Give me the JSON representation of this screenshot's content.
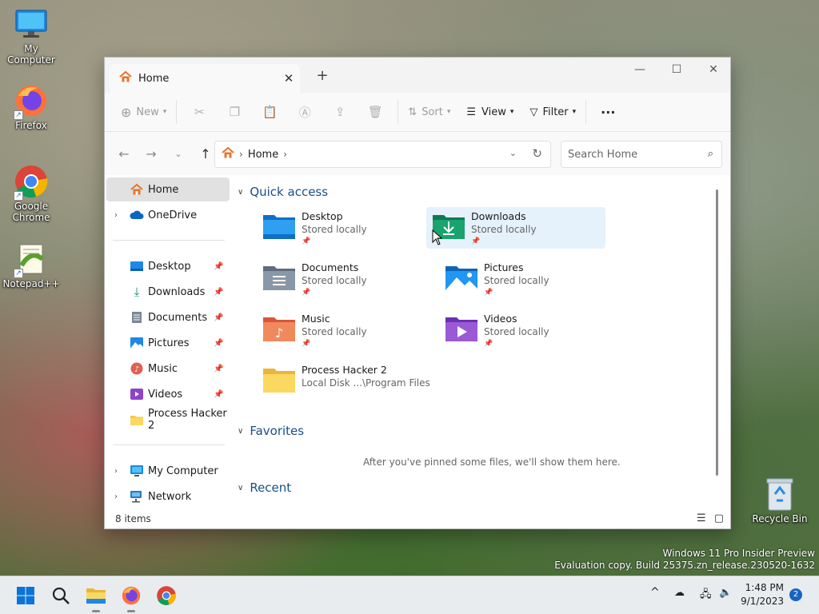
{
  "desktop": {
    "icons": [
      {
        "label": "My Computer"
      },
      {
        "label": "Firefox"
      },
      {
        "label": "Google Chrome"
      },
      {
        "label": "Notepad++"
      },
      {
        "label": "Recycle Bin"
      }
    ],
    "watermark": [
      "Windows 11 Pro Insider Preview",
      "Evaluation copy. Build 25375.zn_release.230520-1632"
    ]
  },
  "explorer": {
    "tab_title": "Home",
    "new_tab_symbol": "+",
    "toolbar": {
      "new": "New",
      "sort": "Sort",
      "view": "View",
      "filter": "Filter",
      "more": "···"
    },
    "address": {
      "crumb": "Home"
    },
    "search": {
      "placeholder": "Search Home"
    },
    "sidebar": {
      "home": "Home",
      "onedrive": "OneDrive",
      "pinned": [
        {
          "label": "Desktop"
        },
        {
          "label": "Downloads"
        },
        {
          "label": "Documents"
        },
        {
          "label": "Pictures"
        },
        {
          "label": "Music"
        },
        {
          "label": "Videos"
        },
        {
          "label": "Process Hacker 2"
        }
      ],
      "my_computer": "My Computer",
      "network": "Network"
    },
    "sections": {
      "quick_access": "Quick access",
      "favorites": "Favorites",
      "recent": "Recent",
      "favorites_empty": "After you've pinned some files, we'll show them here."
    },
    "quick_access": [
      {
        "name": "Desktop",
        "sub": "Stored locally"
      },
      {
        "name": "Downloads",
        "sub": "Stored locally"
      },
      {
        "name": "Documents",
        "sub": "Stored locally"
      },
      {
        "name": "Pictures",
        "sub": "Stored locally"
      },
      {
        "name": "Music",
        "sub": "Stored locally"
      },
      {
        "name": "Videos",
        "sub": "Stored locally"
      },
      {
        "name": "Process Hacker 2",
        "sub": "Local Disk ...\\Program Files"
      }
    ],
    "status": "8 items"
  },
  "taskbar": {
    "time": "1:48 PM",
    "date": "9/1/2023",
    "notification_count": "2"
  },
  "colors": {
    "accent": "#0067c0",
    "folder_yellow": "#f7c948",
    "selection": "#e5f1fb"
  }
}
